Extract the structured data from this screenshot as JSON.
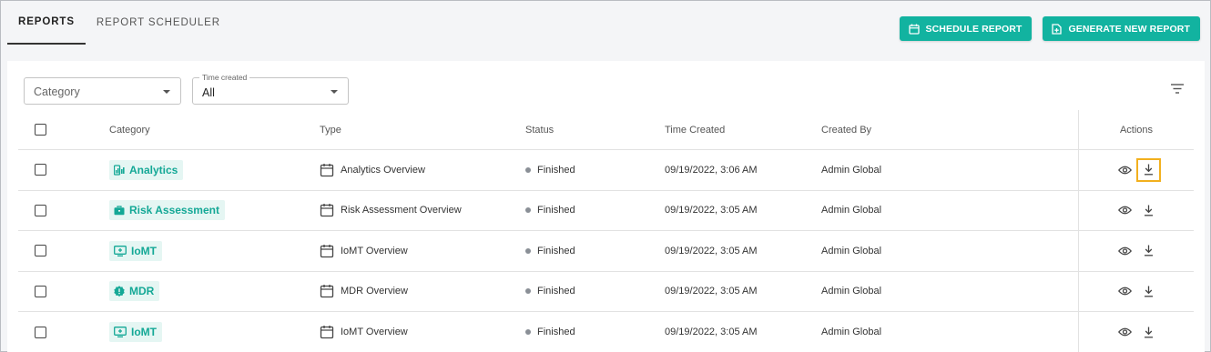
{
  "tabs": [
    {
      "label": "REPORTS",
      "active": true
    },
    {
      "label": "REPORT SCHEDULER",
      "active": false
    }
  ],
  "buttons": {
    "schedule": "SCHEDULE REPORT",
    "generate": "GENERATE NEW REPORT"
  },
  "filters": {
    "category_placeholder": "Category",
    "time_legend": "Time created",
    "time_value": "All"
  },
  "columns": {
    "category": "Category",
    "type": "Type",
    "status": "Status",
    "time_created": "Time Created",
    "created_by": "Created By",
    "actions": "Actions"
  },
  "rows": [
    {
      "category": "Analytics",
      "category_icon": "analytics-icon",
      "type": "Analytics Overview",
      "status": "Finished",
      "time": "09/19/2022, 3:06 AM",
      "by": "Admin Global"
    },
    {
      "category": "Risk Assessment",
      "category_icon": "briefcase-icon",
      "type": "Risk Assessment Overview",
      "status": "Finished",
      "time": "09/19/2022, 3:05 AM",
      "by": "Admin Global"
    },
    {
      "category": "IoMT",
      "category_icon": "iomt-monitor-icon",
      "type": "IoMT Overview",
      "status": "Finished",
      "time": "09/19/2022, 3:05 AM",
      "by": "Admin Global"
    },
    {
      "category": "MDR",
      "category_icon": "mdr-badge-icon",
      "type": "MDR Overview",
      "status": "Finished",
      "time": "09/19/2022, 3:05 AM",
      "by": "Admin Global"
    },
    {
      "category": "IoMT",
      "category_icon": "iomt-monitor-icon",
      "type": "IoMT Overview",
      "status": "Finished",
      "time": "09/19/2022, 3:05 AM",
      "by": "Admin Global"
    }
  ],
  "colors": {
    "accent": "#12b3a0",
    "chip_bg": "#e5f6f3",
    "focus_outline": "#f2b01e",
    "status_dot": "#8a8f96"
  }
}
